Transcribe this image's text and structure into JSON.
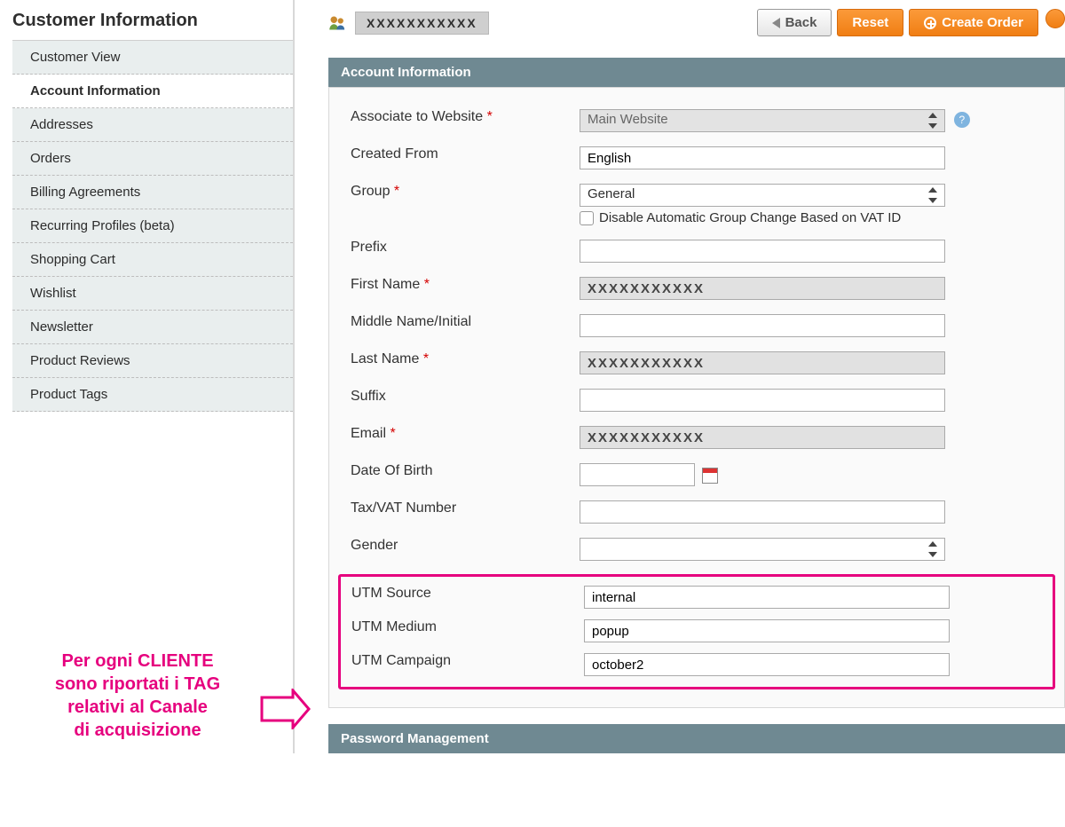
{
  "sidebar": {
    "title": "Customer Information",
    "items": [
      {
        "label": "Customer View",
        "active": false
      },
      {
        "label": "Account Information",
        "active": true
      },
      {
        "label": "Addresses",
        "active": false
      },
      {
        "label": "Orders",
        "active": false
      },
      {
        "label": "Billing Agreements",
        "active": false
      },
      {
        "label": "Recurring Profiles (beta)",
        "active": false
      },
      {
        "label": "Shopping Cart",
        "active": false
      },
      {
        "label": "Wishlist",
        "active": false
      },
      {
        "label": "Newsletter",
        "active": false
      },
      {
        "label": "Product Reviews",
        "active": false
      },
      {
        "label": "Product Tags",
        "active": false
      }
    ]
  },
  "header": {
    "customer_name": "XXXXXXXXXXX",
    "back_label": "Back",
    "reset_label": "Reset",
    "create_order_label": "Create Order"
  },
  "panel": {
    "title": "Account Information",
    "password_title": "Password Management"
  },
  "fields": {
    "website": {
      "label": "Associate to Website",
      "required": true,
      "value": "Main Website",
      "help": "?"
    },
    "created_from": {
      "label": "Created From",
      "value": "English"
    },
    "group": {
      "label": "Group",
      "required": true,
      "value": "General",
      "checkbox_label": "Disable Automatic Group Change Based on VAT ID"
    },
    "prefix": {
      "label": "Prefix",
      "value": ""
    },
    "first_name": {
      "label": "First Name",
      "required": true,
      "value": "XXXXXXXXXXX"
    },
    "middle_name": {
      "label": "Middle Name/Initial",
      "value": ""
    },
    "last_name": {
      "label": "Last Name",
      "required": true,
      "value": "XXXXXXXXXXX"
    },
    "suffix": {
      "label": "Suffix",
      "value": ""
    },
    "email": {
      "label": "Email",
      "required": true,
      "value": "XXXXXXXXXXX"
    },
    "dob": {
      "label": "Date Of Birth",
      "value": ""
    },
    "tax_vat": {
      "label": "Tax/VAT Number",
      "value": ""
    },
    "gender": {
      "label": "Gender",
      "value": ""
    },
    "utm_source": {
      "label": "UTM Source",
      "value": "internal"
    },
    "utm_medium": {
      "label": "UTM Medium",
      "value": "popup"
    },
    "utm_campaign": {
      "label": "UTM Campaign",
      "value": "october2"
    }
  },
  "callout": {
    "line1": "Per ogni CLIENTE",
    "line2": "sono riportati i TAG",
    "line3": "relativi al Canale",
    "line4": "di acquisizione"
  }
}
